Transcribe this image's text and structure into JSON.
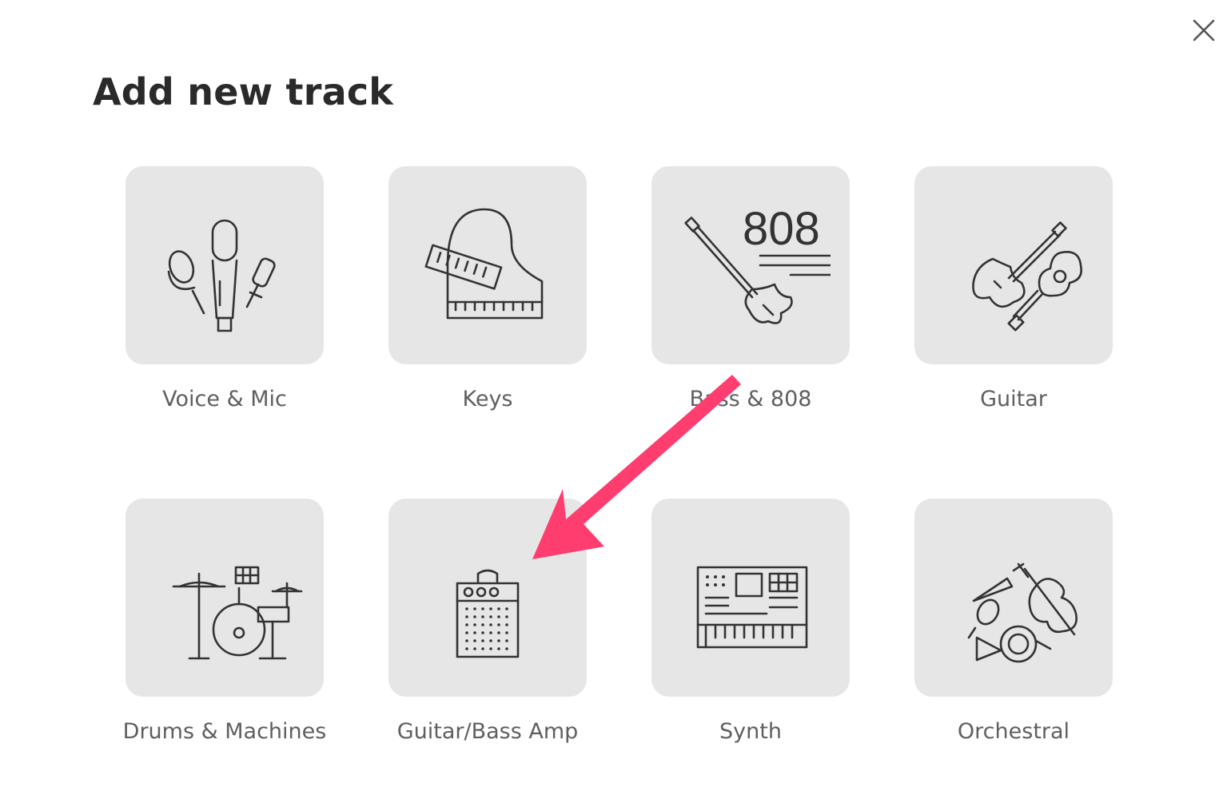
{
  "dialog": {
    "title": "Add new track",
    "close_icon": "close-icon"
  },
  "tiles": [
    {
      "label": "Voice & Mic",
      "icon": "microphones-icon"
    },
    {
      "label": "Keys",
      "icon": "piano-keys-icon"
    },
    {
      "label": "Bass & 808",
      "icon": "bass-808-icon"
    },
    {
      "label": "Guitar",
      "icon": "guitars-icon"
    },
    {
      "label": "Drums & Machines",
      "icon": "drum-kit-icon"
    },
    {
      "label": "Guitar/Bass Amp",
      "icon": "amplifier-icon"
    },
    {
      "label": "Synth",
      "icon": "synthesizer-icon"
    },
    {
      "label": "Orchestral",
      "icon": "orchestral-instruments-icon"
    }
  ],
  "bass_icon_text": "808",
  "annotation": {
    "arrow_color": "#ff3d6e",
    "points_to": "Guitar/Bass Amp"
  },
  "colors": {
    "tile_background": "#e6e6e6",
    "icon_stroke": "#333333",
    "label_text": "#5f5f5f",
    "title_text": "#2a2a2a"
  }
}
